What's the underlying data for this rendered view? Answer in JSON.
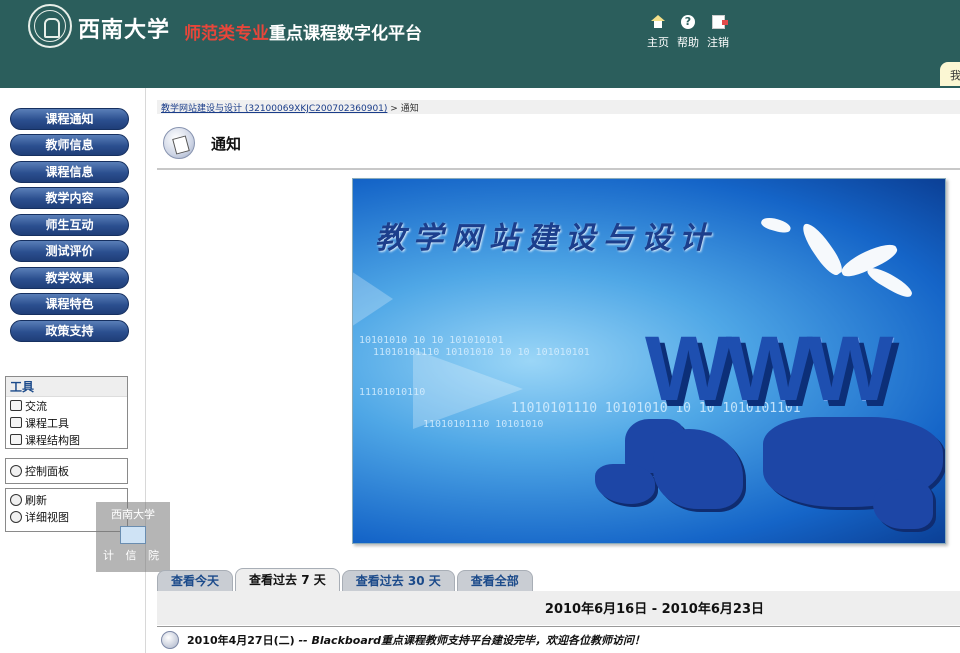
{
  "header": {
    "logo_name": "西南大学",
    "title_accent": "师范类专业",
    "title_rest": "重点课程数字化平台",
    "nav": [
      {
        "label": "主页",
        "icon": "home-icon"
      },
      {
        "label": "帮助",
        "icon": "help-icon"
      },
      {
        "label": "注销",
        "icon": "logout-icon"
      }
    ],
    "corner_text": "我"
  },
  "sidebar": {
    "nav_buttons": [
      "课程通知",
      "教师信息",
      "课程信息",
      "教学内容",
      "师生互动",
      "测试评价",
      "教学效果",
      "课程特色",
      "政策支持"
    ],
    "tools": {
      "heading": "工具",
      "items": [
        "交流",
        "课程工具",
        "课程结构图"
      ]
    },
    "control_panel": "控制面板",
    "refresh": "刷新",
    "detail_view": "详细视图"
  },
  "watermark": {
    "top": "西南大学",
    "bottom": "计 信 院"
  },
  "breadcrumb": {
    "course": "教学网站建设与设计 (32100069XKJC200702360901)",
    "separator": ">",
    "current": "通知"
  },
  "page": {
    "title": "通知"
  },
  "banner": {
    "title": "教学网站建设与设计",
    "mark": "WWW",
    "binary": [
      "10101010  10 10 101010101",
      "11010101110   10101010   10 10 101010101",
      "11101010110",
      "11010101110   10101010   10 10 1010101101",
      "11010101110   10101010"
    ]
  },
  "tabs": [
    {
      "label": "查看今天",
      "active": false
    },
    {
      "label": "查看过去 7 天",
      "active": true
    },
    {
      "label": "查看过去 30 天",
      "active": false
    },
    {
      "label": "查看全部",
      "active": false
    }
  ],
  "date_range": "2010年6月16日  - 2010年6月23日",
  "announcement": {
    "date": "2010年4月27日(二)",
    "separator": "--",
    "text": "Blackboard重点课程教师支持平台建设完毕，欢迎各位教师访问！"
  }
}
